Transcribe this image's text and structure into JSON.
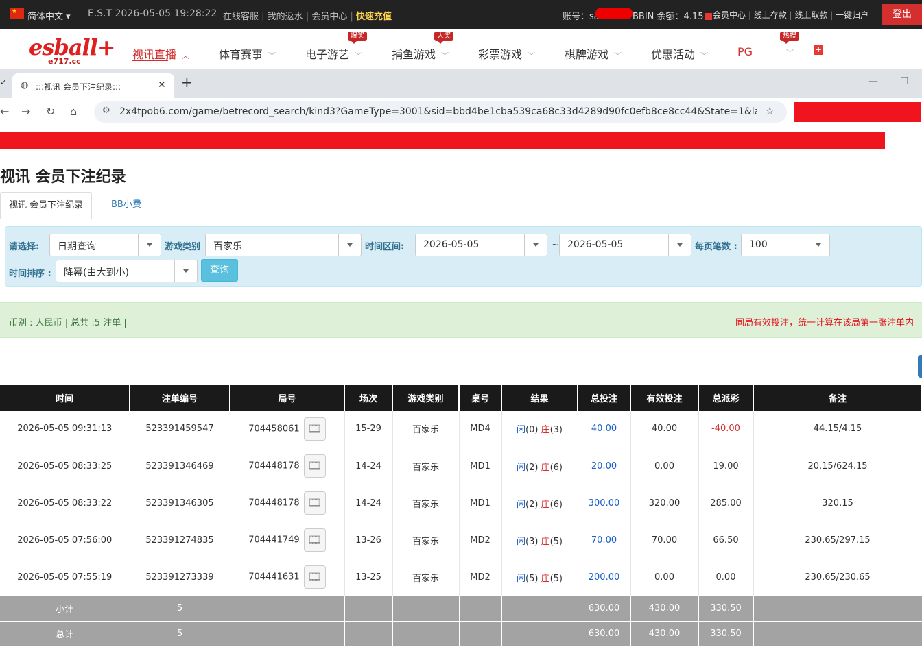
{
  "topbar": {
    "lang": "简体中文 ▾",
    "clock": "E.S.T 2026-05-05 19:28:22",
    "links": [
      "在线客服",
      "我的返水",
      "会员中心"
    ],
    "recharge": "快速充值",
    "account_label": "账号：sa",
    "balance": "BBIN 余额：4.15",
    "right_links": [
      "会员中心",
      "线上存款",
      "线上取款",
      "一键归户"
    ],
    "logout": "登出"
  },
  "nav": {
    "logo": "esball+",
    "logo_sub": "e717.cc",
    "items": [
      "视讯直播",
      "体育赛事",
      "电子游艺",
      "捕鱼游戏",
      "彩票游戏",
      "棋牌游戏",
      "优惠活动",
      "PG"
    ],
    "badges": [
      "爆奖",
      "大奖",
      "热搜"
    ],
    "chevron": "﹀",
    "chevron_up": "︿"
  },
  "browser": {
    "tab_title": ":::视讯 会员下注纪录:::",
    "url": "2x4tpob6.com/game/betrecord_search/kind3?GameType=3001&sid=bbd4be1cba539ca68c33d4289d90fc0efb8ce8cc44&State=1&lang=..."
  },
  "page": {
    "title": "视讯 会员下注纪录",
    "tabs": [
      "视讯 会员下注纪录",
      "BB小费"
    ]
  },
  "filter": {
    "select_label": "请选择:",
    "select_value": "日期查询",
    "type_label": "游戏类别",
    "type_value": "百家乐",
    "range_label": "时间区间:",
    "date_from": "2026-05-05",
    "tilde": "~",
    "date_to": "2026-05-05",
    "per_page_label": "每页笔数 :",
    "per_page_value": "100",
    "sort_label": "时间排序 :",
    "sort_value": "降幂(由大到小)",
    "query_button": "查询"
  },
  "summary": {
    "left": "币别 : 人民币 | 总共 :5 注单 |",
    "right": "同局有效投注，统一计算在该局第一张注单内"
  },
  "table": {
    "headers": [
      "时间",
      "注单编号",
      "局号",
      "场次",
      "游戏类别",
      "桌号",
      "结果",
      "总投注",
      "有效投注",
      "总派彩",
      "备注"
    ],
    "rows": [
      {
        "time": "2026-05-05 09:31:13",
        "bet_id": "523391459547",
        "round": "704458061",
        "session": "15-29",
        "game": "百家乐",
        "table": "MD4",
        "r_player": "闲",
        "r_player_n": "(0)",
        "r_banker": "庄",
        "r_banker_n": "(3)",
        "total": "40.00",
        "valid": "40.00",
        "payout": "-40.00",
        "note": "44.15/4.15"
      },
      {
        "time": "2026-05-05 08:33:25",
        "bet_id": "523391346469",
        "round": "704448178",
        "session": "14-24",
        "game": "百家乐",
        "table": "MD1",
        "r_player": "闲",
        "r_player_n": "(2)",
        "r_banker": "庄",
        "r_banker_n": "(6)",
        "total": "20.00",
        "valid": "0.00",
        "payout": "19.00",
        "note": "20.15/624.15"
      },
      {
        "time": "2026-05-05 08:33:22",
        "bet_id": "523391346305",
        "round": "704448178",
        "session": "14-24",
        "game": "百家乐",
        "table": "MD1",
        "r_player": "闲",
        "r_player_n": "(2)",
        "r_banker": "庄",
        "r_banker_n": "(6)",
        "total": "300.00",
        "valid": "320.00",
        "payout": "285.00",
        "note": "320.15"
      },
      {
        "time": "2026-05-05 07:56:00",
        "bet_id": "523391274835",
        "round": "704441749",
        "session": "13-26",
        "game": "百家乐",
        "table": "MD2",
        "r_player": "闲",
        "r_player_n": "(3)",
        "r_banker": "庄",
        "r_banker_n": "(5)",
        "total": "70.00",
        "valid": "70.00",
        "payout": "66.50",
        "note": "230.65/297.15"
      },
      {
        "time": "2026-05-05 07:55:19",
        "bet_id": "523391273339",
        "round": "704441631",
        "session": "13-25",
        "game": "百家乐",
        "table": "MD2",
        "r_player": "闲",
        "r_player_n": "(5)",
        "r_banker": "庄",
        "r_banker_n": "(5)",
        "total": "200.00",
        "valid": "0.00",
        "payout": "0.00",
        "note": "230.65/230.65"
      }
    ],
    "subtotal": {
      "label": "小计",
      "count": "5",
      "total": "630.00",
      "valid": "430.00",
      "payout": "330.50"
    },
    "grandtotal": {
      "label": "总计",
      "count": "5",
      "total": "630.00",
      "valid": "430.00",
      "payout": "330.50"
    }
  }
}
